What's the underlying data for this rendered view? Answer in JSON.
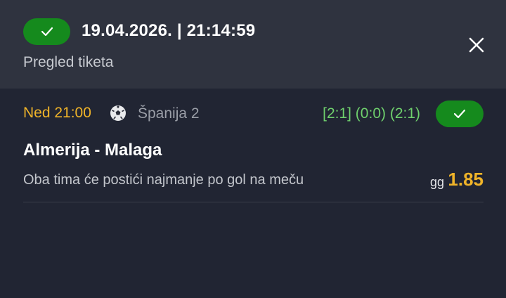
{
  "header": {
    "datetime": "19.04.2026. | 21:14:59",
    "subtitle": "Pregled tiketa",
    "status_icon": "check-icon",
    "close_icon": "close-icon"
  },
  "bet": {
    "time": "Ned 21:00",
    "sport_icon": "soccer-ball-icon",
    "league": "Španija 2",
    "score": "[2:1] (0:0) (2:1)",
    "status_icon": "check-icon",
    "match": "Almerija - Malaga",
    "market": "Oba tima će postići najmanje po gol na meču",
    "pick": "gg",
    "odds": "1.85"
  },
  "colors": {
    "background": "#212533",
    "header_background": "#2f333f",
    "win_green": "#158a1d",
    "accent_yellow": "#f0b429",
    "score_green": "#6fd06d"
  }
}
